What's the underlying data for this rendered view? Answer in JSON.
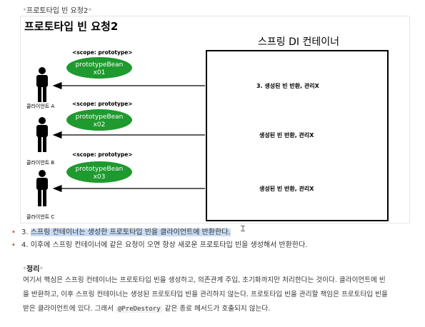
{
  "caption": {
    "marker": "*",
    "text": "프로토타입 빈 요청2"
  },
  "diagram": {
    "title": "프로토타입 빈 요청2",
    "container_label": "스프링 DI 컨테이너",
    "beans": [
      {
        "scope": "<scope: prototype>",
        "name": "prototypeBean",
        "id": "x01",
        "client": "클라이언트 A",
        "arrow_label": "3. 생성된 빈 반환, 관리X"
      },
      {
        "scope": "<scope: prototype>",
        "name": "prototypeBean",
        "id": "x02",
        "client": "클라이언트 B",
        "arrow_label": "생성된 빈 반환, 관리X"
      },
      {
        "scope": "<scope: prototype>",
        "name": "prototypeBean",
        "id": "x03",
        "client": "클라이언트 C",
        "arrow_label": "생성된 빈 반환, 관리X"
      }
    ],
    "colors": {
      "bean_fill": "#1e9a2e",
      "arrow": "#000000"
    }
  },
  "bullets": [
    {
      "num": "3. ",
      "text": "스프링 컨테이너는 생성한 프로토타입 빈을 클라이언트에 반환한다."
    },
    {
      "num": "4. ",
      "text": "이후에 스프링 컨테이너에 같은 요청이 오면 항상 새로운 프로토타입 빈을 생성해서 반환한다."
    }
  ],
  "summary": {
    "marker": "*",
    "title": "정리",
    "line1": "여기서 핵심은 스프링 컨테이너는 프로토타입 빈을 생성하고, 의존관계 주입, 초기화까지만 처리한다는 것이다. 클라이언트에 빈",
    "line2": "을 반환하고, 이후 스프링 컨테이너는 생성된 프로토타입 빈을 관리하지 않는다. 프로토타입 빈을 관리할 책임은 프로토타입 빈을",
    "line3_before": "받은 클라이언트에 있다. 그래서 ",
    "line3_code": "@PreDestory",
    "line3_after": " 같은 종료 메서드가 호출되지 않는다."
  }
}
